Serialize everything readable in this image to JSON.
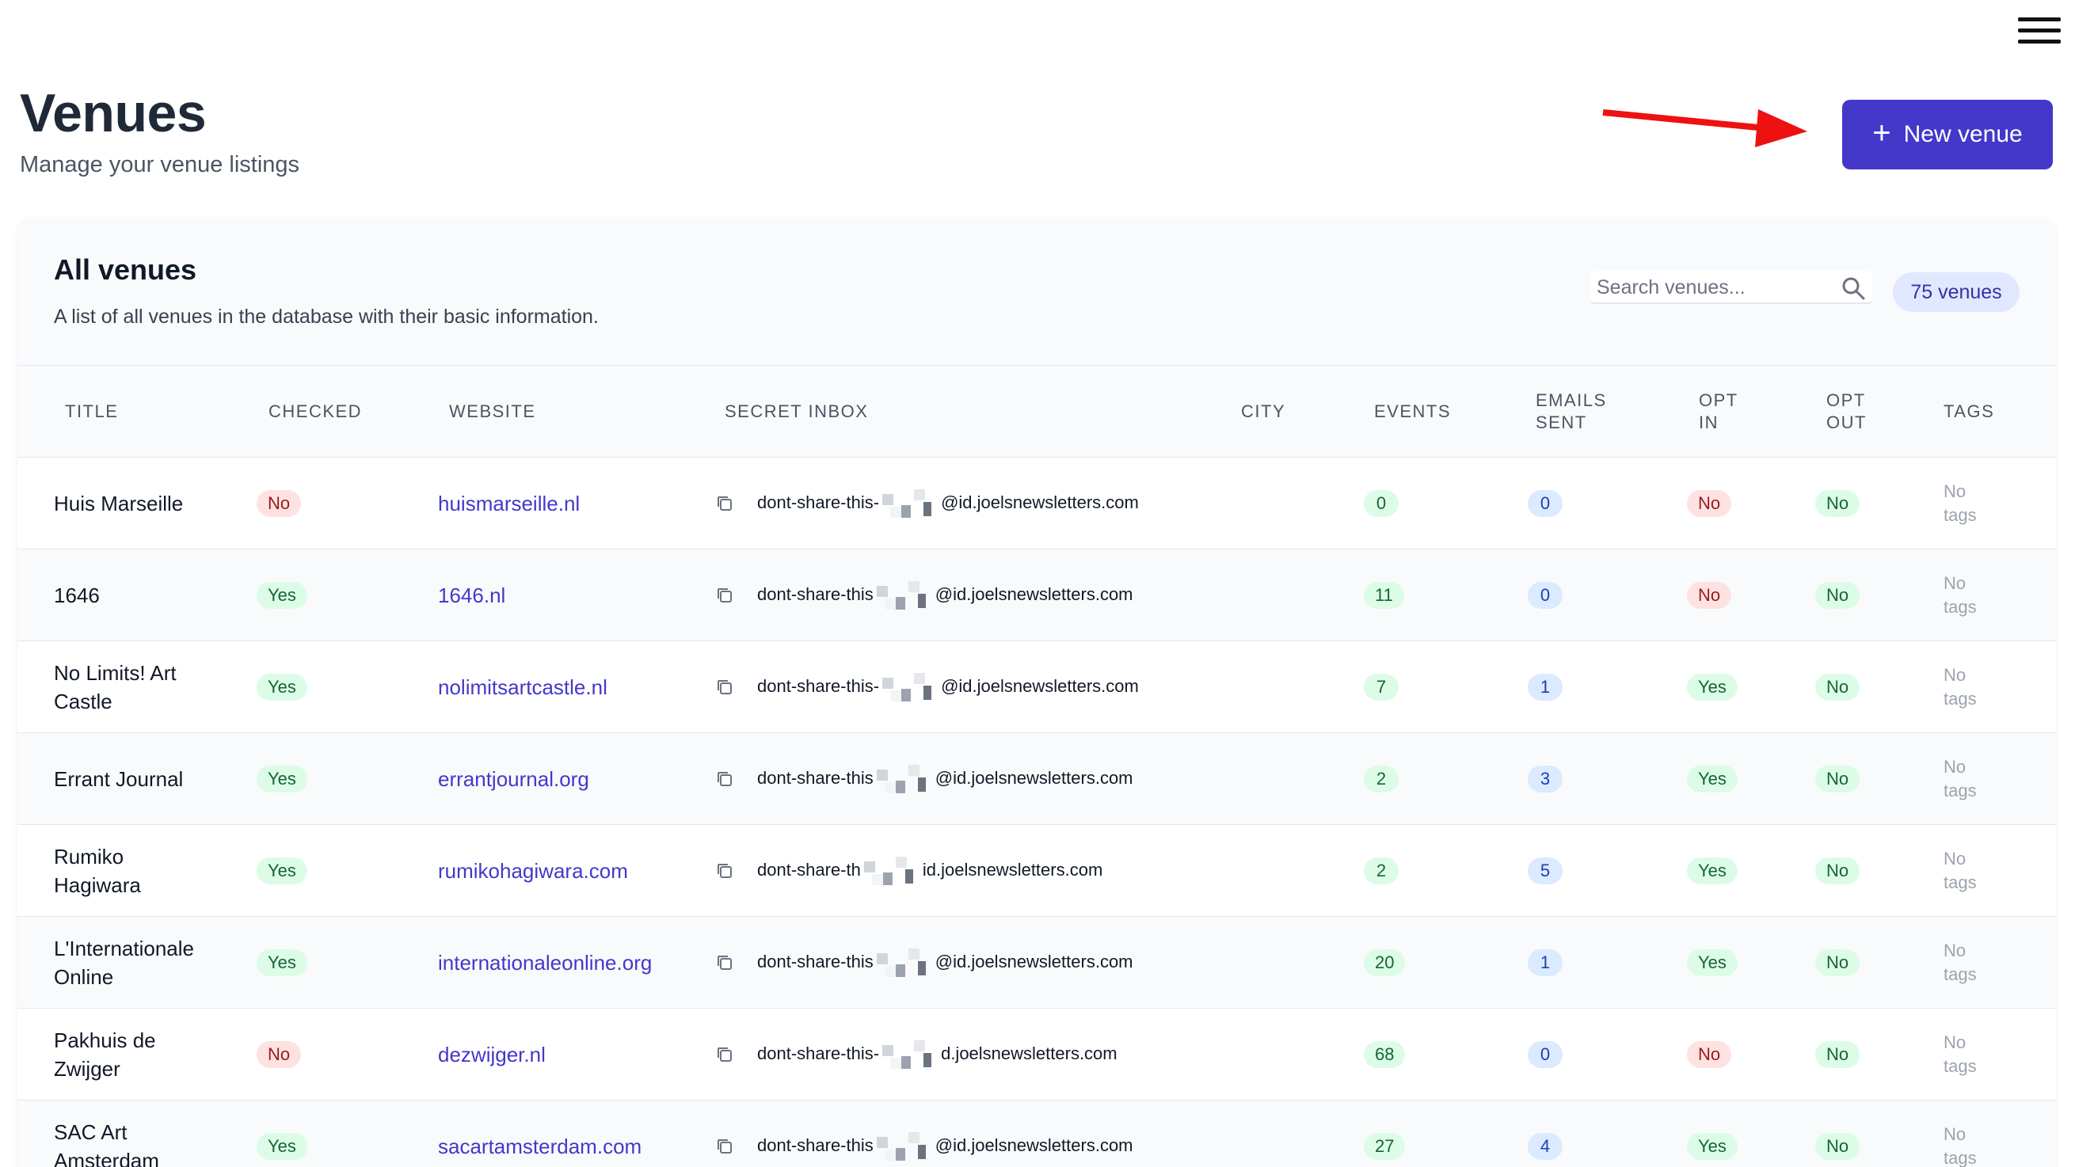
{
  "page": {
    "title": "Venues",
    "subtitle": "Manage your venue listings",
    "new_button_label": "New venue"
  },
  "card": {
    "title": "All venues",
    "description": "A list of all venues in the database with their basic information.",
    "search_placeholder": "Search venues...",
    "count_label": "75 venues"
  },
  "columns": {
    "title": "TITLE",
    "checked": "CHECKED",
    "website": "WEBSITE",
    "secret_inbox": "SECRET INBOX",
    "city": "CITY",
    "events": "EVENTS",
    "emails_sent_1": "EMAILS",
    "emails_sent_2": "SENT",
    "opt_in_1": "OPT",
    "opt_in_2": "IN",
    "opt_out_1": "OPT",
    "opt_out_2": "OUT",
    "tags": "TAGS"
  },
  "rows": [
    {
      "title_1": "Huis Marseille",
      "title_2": "",
      "checked": "No",
      "website": "huismarseille.nl",
      "inbox_prefix": "dont-share-this-",
      "inbox_suffix": "@id.joelsnewsletters.com",
      "city": "",
      "events": "0",
      "emails_sent": "0",
      "opt_in": "No",
      "opt_out": "No",
      "tags_1": "No",
      "tags_2": "tags"
    },
    {
      "title_1": "1646",
      "title_2": "",
      "checked": "Yes",
      "website": "1646.nl",
      "inbox_prefix": "dont-share-this",
      "inbox_suffix": "@id.joelsnewsletters.com",
      "city": "",
      "events": "11",
      "emails_sent": "0",
      "opt_in": "No",
      "opt_out": "No",
      "tags_1": "No",
      "tags_2": "tags"
    },
    {
      "title_1": "No Limits! Art",
      "title_2": "Castle",
      "checked": "Yes",
      "website": "nolimitsartcastle.nl",
      "inbox_prefix": "dont-share-this-",
      "inbox_suffix": "@id.joelsnewsletters.com",
      "city": "",
      "events": "7",
      "emails_sent": "1",
      "opt_in": "Yes",
      "opt_out": "No",
      "tags_1": "No",
      "tags_2": "tags"
    },
    {
      "title_1": "Errant Journal",
      "title_2": "",
      "checked": "Yes",
      "website": "errantjournal.org",
      "inbox_prefix": "dont-share-this",
      "inbox_suffix": "@id.joelsnewsletters.com",
      "city": "",
      "events": "2",
      "emails_sent": "3",
      "opt_in": "Yes",
      "opt_out": "No",
      "tags_1": "No",
      "tags_2": "tags"
    },
    {
      "title_1": "Rumiko",
      "title_2": "Hagiwara",
      "checked": "Yes",
      "website": "rumikohagiwara.com",
      "inbox_prefix": "dont-share-th",
      "inbox_suffix": "id.joelsnewsletters.com",
      "city": "",
      "events": "2",
      "emails_sent": "5",
      "opt_in": "Yes",
      "opt_out": "No",
      "tags_1": "No",
      "tags_2": "tags"
    },
    {
      "title_1": "L'Internationale",
      "title_2": "Online",
      "checked": "Yes",
      "website": "internationaleonline.org",
      "inbox_prefix": "dont-share-this",
      "inbox_suffix": "@id.joelsnewsletters.com",
      "city": "",
      "events": "20",
      "emails_sent": "1",
      "opt_in": "Yes",
      "opt_out": "No",
      "tags_1": "No",
      "tags_2": "tags"
    },
    {
      "title_1": "Pakhuis de",
      "title_2": "Zwijger",
      "checked": "No",
      "website": "dezwijger.nl",
      "inbox_prefix": "dont-share-this-",
      "inbox_suffix": "d.joelsnewsletters.com",
      "city": "",
      "events": "68",
      "emails_sent": "0",
      "opt_in": "No",
      "opt_out": "No",
      "tags_1": "No",
      "tags_2": "tags"
    },
    {
      "title_1": "SAC Art",
      "title_2": "Amsterdam",
      "checked": "Yes",
      "website": "sacartamsterdam.com",
      "inbox_prefix": "dont-share-this",
      "inbox_suffix": "@id.joelsnewsletters.com",
      "city": "",
      "events": "27",
      "emails_sent": "4",
      "opt_in": "Yes",
      "opt_out": "No",
      "tags_1": "No",
      "tags_2": "tags"
    }
  ],
  "icons": {
    "menu": "hamburger-menu-icon",
    "plus": "plus-icon",
    "search": "search-icon",
    "copy": "copy-icon",
    "arrow": "red-arrow-annotation"
  },
  "colors": {
    "primary": "#4338ca",
    "badge_red_bg": "#fee2e2",
    "badge_green_bg": "#dcfce7",
    "badge_blue_bg": "#dbeafe",
    "annotation_arrow": "#ee1111"
  }
}
